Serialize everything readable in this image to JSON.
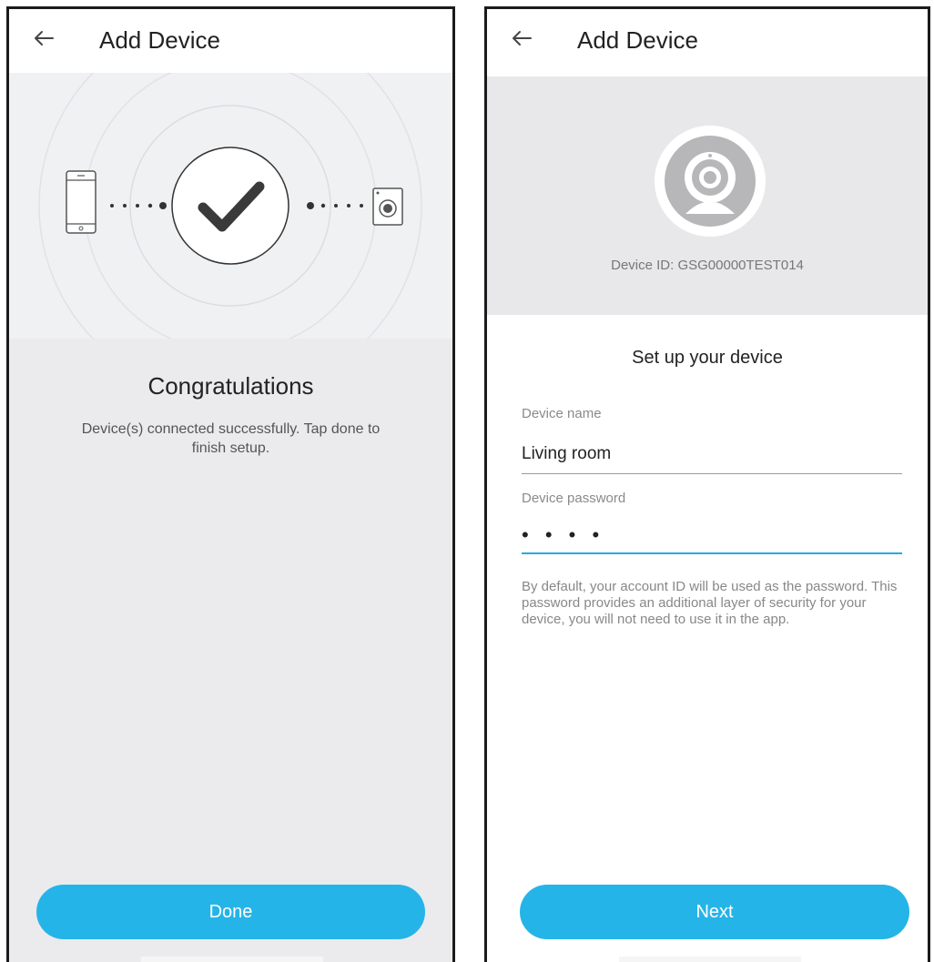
{
  "screens": {
    "left": {
      "title": "Add Device",
      "heading": "Congratulations",
      "message": "Device(s) connected successfully. Tap done to finish setup.",
      "button_label": "Done",
      "dots_left": "• • • •",
      "dots_right": "• • • •"
    },
    "right": {
      "title": "Add Device",
      "device_id": "Device ID: GSG00000TEST014",
      "setup_title": "Set up your device",
      "device_name_label": "Device name",
      "device_name_value": "Living room",
      "device_password_label": "Device password",
      "device_password_value": "• • • •",
      "help_text": "By default, your account ID will be used as the password. This password provides an additional layer of security for your device, you will not need to use it in the app.",
      "button_label": "Next"
    }
  },
  "colors": {
    "accent": "#25b4e8",
    "hero_bg": "#f0f1f3",
    "body_bg": "#ebebee",
    "text_dark": "#222222",
    "text_muted": "#888888"
  },
  "icons": {
    "back": "arrow-left-icon",
    "check": "checkmark-icon",
    "phone": "smartphone-icon",
    "camera": "camera-icon"
  }
}
